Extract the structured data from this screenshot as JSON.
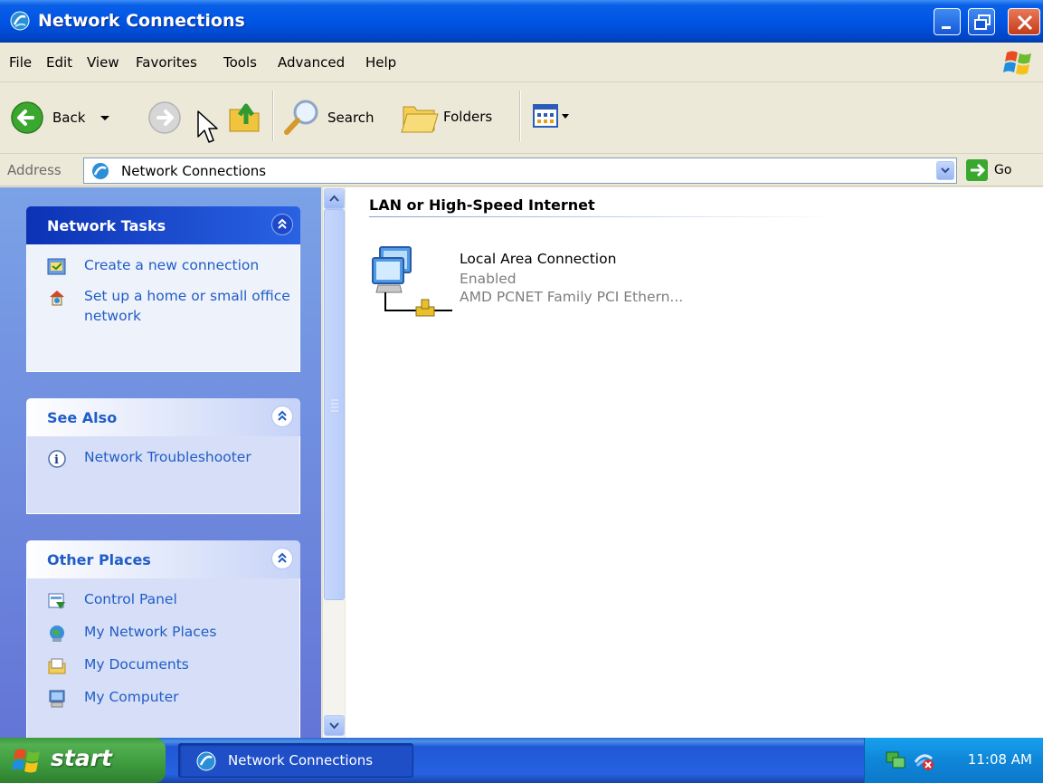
{
  "window": {
    "title": "Network Connections"
  },
  "menu": [
    "File",
    "Edit",
    "View",
    "Favorites",
    "Tools",
    "Advanced",
    "Help"
  ],
  "toolbar": {
    "back_label": "Back",
    "search_label": "Search",
    "folders_label": "Folders"
  },
  "address": {
    "label": "Address",
    "value": "Network Connections",
    "go_label": "Go"
  },
  "taskpane": {
    "network_tasks": {
      "title": "Network Tasks",
      "items": [
        {
          "label": "Create a new connection",
          "icon": "new-connection-icon"
        },
        {
          "label": "Set up a home or small office network",
          "icon": "home-network-icon"
        }
      ]
    },
    "see_also": {
      "title": "See Also",
      "items": [
        {
          "label": "Network Troubleshooter",
          "icon": "info-icon"
        }
      ]
    },
    "other_places": {
      "title": "Other Places",
      "items": [
        {
          "label": "Control Panel",
          "icon": "control-panel-icon"
        },
        {
          "label": "My Network Places",
          "icon": "network-places-icon"
        },
        {
          "label": "My Documents",
          "icon": "documents-icon"
        },
        {
          "label": "My Computer",
          "icon": "computer-icon"
        }
      ]
    }
  },
  "content": {
    "group_header": "LAN or High-Speed Internet",
    "connections": [
      {
        "name": "Local Area Connection",
        "status": "Enabled",
        "device": "AMD PCNET Family PCI Ethern..."
      }
    ]
  },
  "taskbar": {
    "start_label": "start",
    "window_button": "Network Connections",
    "clock": "11:08 AM"
  },
  "colors": {
    "titlebar": "#0055e5",
    "taskpane": "#7ba2e7",
    "link": "#215dc6",
    "start": "#3d9b3d"
  }
}
